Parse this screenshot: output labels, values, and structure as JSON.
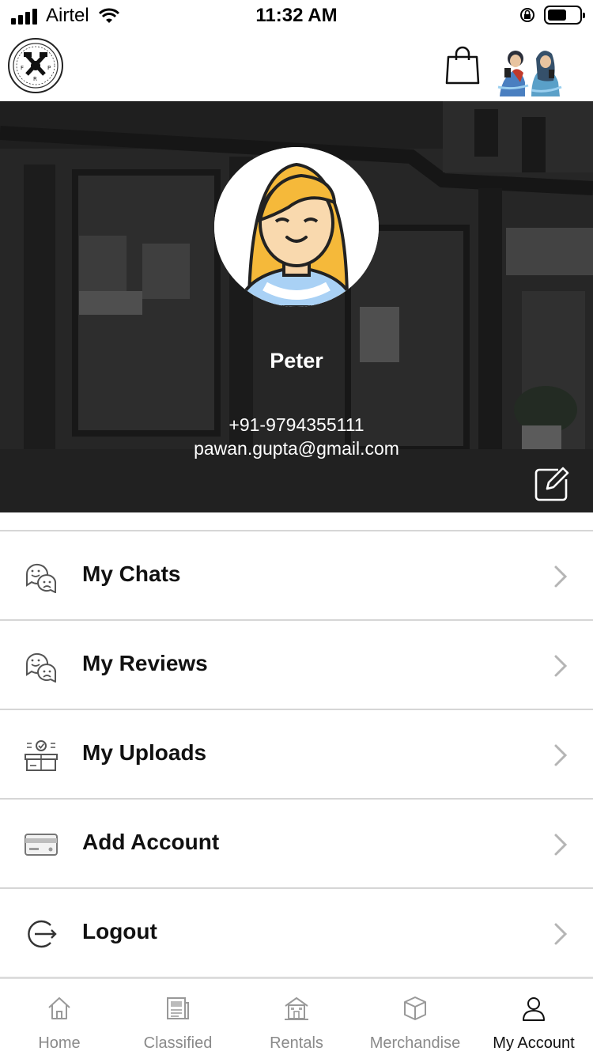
{
  "status_bar": {
    "carrier": "Airtel",
    "time": "11:32 AM"
  },
  "header": {
    "logo_icon": "club-logo-icon",
    "cart_icon": "shopping-bag-icon",
    "avatar_icon": "couple-avatar-icon"
  },
  "profile": {
    "name": "Peter",
    "phone": "+91-9794355111",
    "email": "pawan.gupta@gmail.com",
    "edit_icon": "edit-icon"
  },
  "menu": {
    "items": [
      {
        "label": "My Chats",
        "icon": "chat-bubbles-icon"
      },
      {
        "label": "My Reviews",
        "icon": "review-bubbles-icon"
      },
      {
        "label": "My Uploads",
        "icon": "upload-box-icon"
      },
      {
        "label": "Add Account",
        "icon": "card-icon"
      },
      {
        "label": "Logout",
        "icon": "logout-icon"
      }
    ]
  },
  "tabs": [
    {
      "label": "Home",
      "icon": "home-icon",
      "active": false
    },
    {
      "label": "Classified",
      "icon": "newspaper-icon",
      "active": false
    },
    {
      "label": "Rentals",
      "icon": "building-icon",
      "active": false
    },
    {
      "label": "Merchandise",
      "icon": "box-icon",
      "active": false
    },
    {
      "label": "My Account",
      "icon": "user-icon",
      "active": true
    }
  ],
  "colors": {
    "banner_overlay": "#2f2f2f",
    "divider": "#d6d6d6",
    "tab_inactive": "#8a8a8a",
    "tab_active": "#111111"
  }
}
